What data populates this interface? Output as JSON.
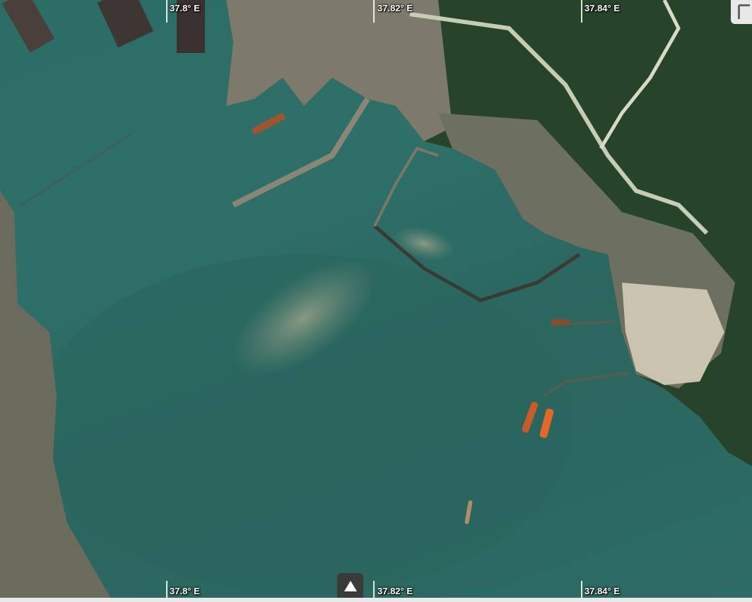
{
  "map": {
    "view": "satellite imagery of a bay with port terminals",
    "colors": {
      "water": "#2e6f68",
      "land_vegetation": "#243f25",
      "urban": "#8b8a7e",
      "oil_sheen": "#9a9d86",
      "ships": "#d4541f"
    }
  },
  "graticule": {
    "top_labels": [
      "37.8° E",
      "37.82° E",
      "37.84° E"
    ],
    "bottom_labels": [
      "37.8° E",
      "37.82° E",
      "37.84° E"
    ]
  },
  "controls": {
    "expand_icon": "triangle-up-icon",
    "corner_icon": "corner-bracket-icon"
  }
}
